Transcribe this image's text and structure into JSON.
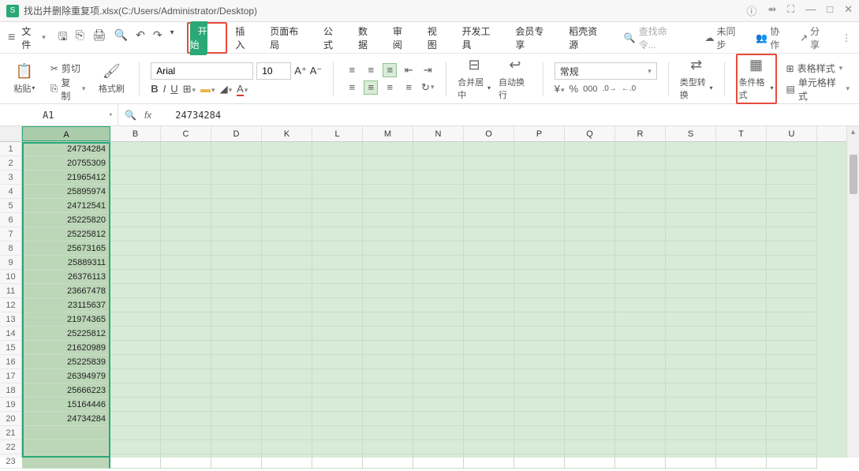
{
  "titlebar": {
    "logo_letter": "S",
    "title": "找出并删除重复项.xlsx(C:/Users/Administrator/Desktop)"
  },
  "menubar": {
    "file_label": "文件",
    "tabs": [
      "开始",
      "插入",
      "页面布局",
      "公式",
      "数据",
      "审阅",
      "视图",
      "开发工具",
      "会员专享",
      "稻壳资源"
    ],
    "search_placeholder": "查找命令...",
    "unsync": "未同步",
    "collab": "协作",
    "share": "分享"
  },
  "ribbon": {
    "paste": "粘贴",
    "cut": "剪切",
    "copy": "复制",
    "fmt_painter": "格式刷",
    "font_name": "Arial",
    "font_size": "10",
    "merge": "合并居中",
    "wrap": "自动换行",
    "numfmt": "常规",
    "type_convert": "类型转换",
    "cond_fmt": "条件格式",
    "table_style": "表格样式",
    "cell_style": "单元格样式"
  },
  "formula_bar": {
    "cell_ref": "A1",
    "value": "24734284"
  },
  "grid": {
    "columns": [
      "A",
      "B",
      "C",
      "D",
      "K",
      "L",
      "M",
      "N",
      "O",
      "P",
      "Q",
      "R",
      "S",
      "T",
      "U"
    ],
    "rows": [
      1,
      2,
      3,
      4,
      5,
      6,
      7,
      8,
      9,
      10,
      11,
      12,
      13,
      14,
      15,
      16,
      17,
      18,
      19,
      20,
      21,
      22,
      23
    ],
    "col_a_values": [
      "24734284",
      "20755309",
      "21965412",
      "25895974",
      "24712541",
      "25225820",
      "25225812",
      "25673165",
      "25889311",
      "26376113",
      "23667478",
      "23115637",
      "21974365",
      "25225812",
      "21620989",
      "25225839",
      "26394979",
      "25666223",
      "15164446",
      "24734284",
      "",
      "",
      ""
    ]
  }
}
